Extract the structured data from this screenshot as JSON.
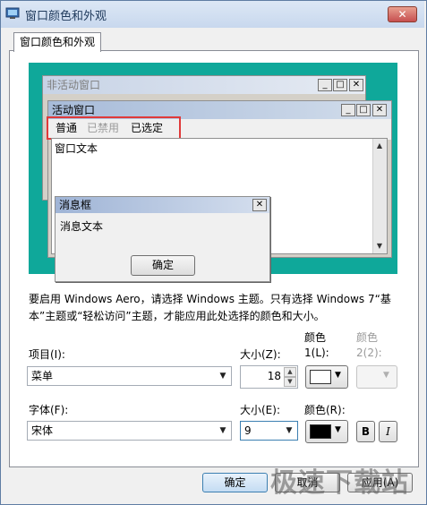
{
  "window": {
    "title": "窗口颜色和外观",
    "close_glyph": "✕"
  },
  "tab": {
    "label": "窗口颜色和外观"
  },
  "preview": {
    "inactive_title": "非活动窗口",
    "active_title": "活动窗口",
    "caption_minimize": "_",
    "caption_maximize": "□",
    "caption_close": "✕",
    "menu": {
      "normal": "普通",
      "disabled": "已禁用",
      "selected": "已选定"
    },
    "window_text": "窗口文本",
    "msgbox": {
      "title": "消息框",
      "text": "消息文本",
      "ok": "确定",
      "close": "✕"
    },
    "scroll_up": "▲",
    "scroll_down": "▼"
  },
  "note": "要启用 Windows Aero，请选择 Windows 主题。只有选择 Windows 7“基本”主题或“轻松访问”主题，才能应用此处选择的颜色和大小。",
  "item": {
    "label": "项目(I):",
    "value": "菜单",
    "size_label": "大小(Z):",
    "size_value": "18",
    "color1_label": "颜色\n1(L):",
    "color1_label_a": "颜色",
    "color1_label_b": "1(L):",
    "color2_label_a": "颜色",
    "color2_label_b": "2(2):",
    "color1_value": "#ffffff"
  },
  "font": {
    "label": "字体(F):",
    "value": "宋体",
    "size_label": "大小(E):",
    "size_value": "9",
    "color_label": "颜色(R):",
    "color_value": "#000000",
    "bold": "B",
    "italic": "I"
  },
  "buttons": {
    "ok": "确定",
    "cancel": "取消",
    "apply": "应用(A)"
  },
  "watermark": "极速下载站",
  "colors": {
    "desktop": "#0fa89a",
    "highlight": "#e03a3a",
    "accent": "#3c7fb1"
  }
}
